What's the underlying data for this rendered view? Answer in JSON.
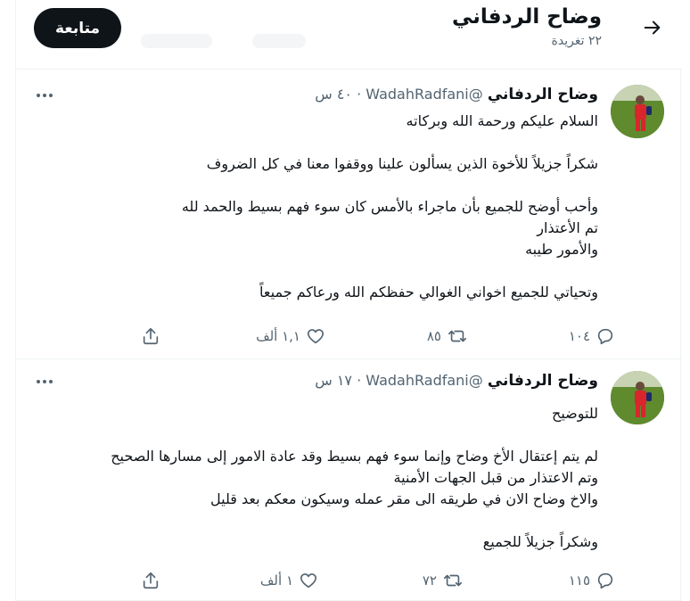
{
  "header": {
    "name": "وضاح الردفاني",
    "tweet_count": "٢٢ تغريدة",
    "follow_label": "متابعة"
  },
  "tweets": [
    {
      "name": "وضاح الردفاني",
      "handle": "@WadahRadfani",
      "dot": "·",
      "time": "٤٠ س",
      "lines": [
        "السلام عليكم ورحمة الله وبركاته",
        "",
        "شكراً جزيلاً للأخوة الذين يسألون علينا ووقفوا معنا في كل الضروف",
        "",
        "وأحب أوضح للجميع بأن ماجراء بالأمس كان سوء فهم بسيط والحمد لله",
        "تم الأعتذار",
        "والأمور طيبه",
        "",
        "وتحياتي للجميع اخواني الغوالي حفظكم الله ورعاكم جميعاً"
      ],
      "replies": "١٠٤",
      "retweets": "٨٥",
      "likes": "١,١ ألف"
    },
    {
      "name": "وضاح الردفاني",
      "handle": "@WadahRadfani",
      "dot": "·",
      "time": "١٧ س",
      "lines": [
        "للتوضيح",
        "",
        "لم يتم إعتقال الأخ وضاح وإنما سوء فهم بسيط وقد عادة الامور إلى مسارها الصحيح",
        "وتم الاعتذار من قبل الجهات الأمنية",
        "والاخ وضاح الان في طريقه الى مقر عمله وسيكون معكم بعد قليل",
        "",
        "وشكراً جزيلاً للجميع"
      ],
      "replies": "١١٥",
      "retweets": "٧٢",
      "likes": "١ ألف"
    }
  ],
  "icons": {
    "back": "arrow-right-icon",
    "more": "more-icon",
    "reply": "reply-icon",
    "retweet": "retweet-icon",
    "like": "heart-icon",
    "share": "share-icon"
  },
  "colors": {
    "text": "#0f1419",
    "secondary": "#536471",
    "button_bg": "#0f1419",
    "border": "#eff3f4"
  }
}
